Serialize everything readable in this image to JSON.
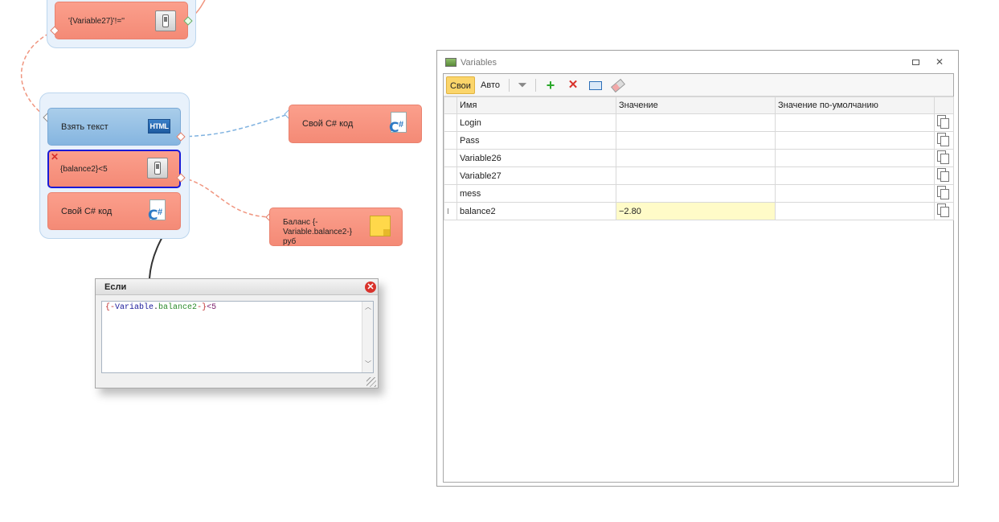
{
  "canvas": {
    "nodes": {
      "variable27_check": "'{Variable27}'!=''",
      "take_text": "Взять текст",
      "balance_check": "{balance2}<5",
      "own_csharp_1": "Свой C# код",
      "own_csharp_2": "Свой C# код",
      "balance_note": "Баланс {-Variable.balance2-}руб"
    },
    "icons": {
      "html_label": "HTML"
    }
  },
  "if_popup": {
    "title": "Если",
    "code": {
      "open": "{-",
      "var": "Variable",
      "dot": ".",
      "name": "balance2",
      "close": "-}",
      "tail": "<5"
    }
  },
  "variables_window": {
    "title": "Variables",
    "toolbar": {
      "own_tab": "Свои",
      "auto_tab": "Авто"
    },
    "columns": [
      "Имя",
      "Значение",
      "Значение по-умолчанию"
    ],
    "rows": [
      {
        "name": "Login",
        "value": "",
        "default": ""
      },
      {
        "name": "Pass",
        "value": "",
        "default": ""
      },
      {
        "name": "Variable26",
        "value": "",
        "default": ""
      },
      {
        "name": "Variable27",
        "value": "",
        "default": ""
      },
      {
        "name": "mess",
        "value": "",
        "default": ""
      },
      {
        "name": "balance2",
        "value": "−2.80",
        "default": ""
      }
    ],
    "highlight_color": "#fffbc8",
    "active_tab_color": "#fbd56a"
  },
  "colors": {
    "node_red": "#f48a76",
    "node_blue": "#85b5e0",
    "group_bg": "#e8f1fb",
    "wire_red": "#f0957f",
    "wire_blue": "#7fb2e0",
    "selected_border": "#1a1ad6"
  }
}
